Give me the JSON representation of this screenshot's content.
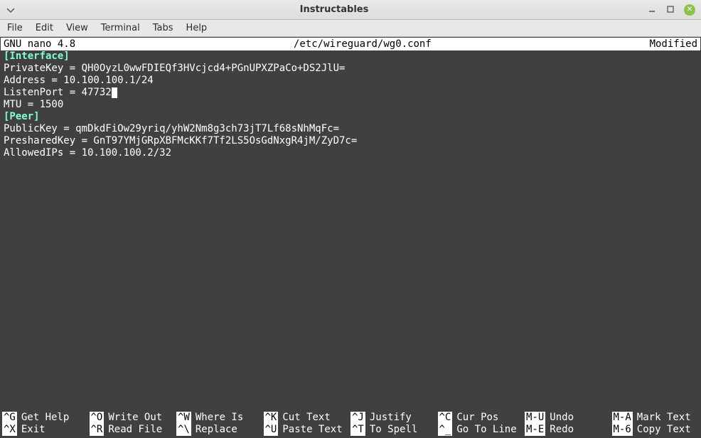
{
  "window": {
    "title": "Instructables"
  },
  "menubar": [
    "File",
    "Edit",
    "View",
    "Terminal",
    "Tabs",
    "Help"
  ],
  "nano": {
    "app": "GNU nano 4.8",
    "filename": "/etc/wireguard/wg0.conf",
    "status": "Modified"
  },
  "content": {
    "sec1": "[Interface]",
    "l1": "PrivateKey = QH0OyzL0wwFDIEQf3HVcjcd4+PGnUPXZPaCo+DS2JlU=",
    "l2": "Address = 10.100.100.1/24",
    "l3a": "ListenPort = 47732",
    "l4": "MTU = 1500",
    "blank": "",
    "sec2": "[Peer]",
    "l5": "PublicKey = qmDkdFiOw29yriq/yhW2Nm8g3ch73jT7Lf68sNhMqFc=",
    "l6": "PresharedKey = GnT97YMjGRpXBFMcKKf7Tf2LS5OsGdNxgR4jM/ZyD7c=",
    "l7": "AllowedIPs = 10.100.100.2/32"
  },
  "shortcuts": {
    "row1": [
      {
        "k": "^G",
        "t": "Get Help"
      },
      {
        "k": "^O",
        "t": "Write Out"
      },
      {
        "k": "^W",
        "t": "Where Is"
      },
      {
        "k": "^K",
        "t": "Cut Text"
      },
      {
        "k": "^J",
        "t": "Justify"
      },
      {
        "k": "^C",
        "t": "Cur Pos"
      },
      {
        "k": "M-U",
        "t": "Undo"
      },
      {
        "k": "M-A",
        "t": "Mark Text"
      }
    ],
    "row2": [
      {
        "k": "^X",
        "t": "Exit"
      },
      {
        "k": "^R",
        "t": "Read File"
      },
      {
        "k": "^\\",
        "t": "Replace"
      },
      {
        "k": "^U",
        "t": "Paste Text"
      },
      {
        "k": "^T",
        "t": "To Spell"
      },
      {
        "k": "^_",
        "t": "Go To Line"
      },
      {
        "k": "M-E",
        "t": "Redo"
      },
      {
        "k": "M-6",
        "t": "Copy Text"
      }
    ]
  }
}
